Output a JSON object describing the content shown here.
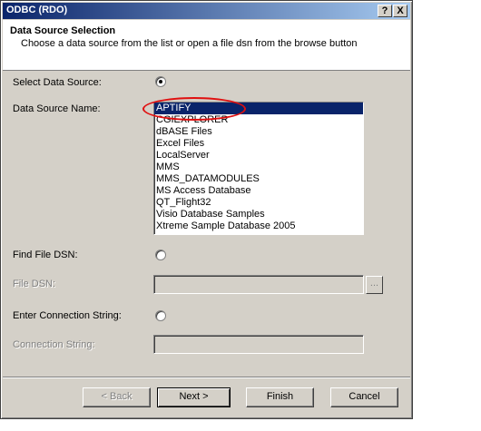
{
  "window": {
    "title": "ODBC (RDO)",
    "help_button": "?",
    "close_button": "X"
  },
  "header": {
    "title": "Data Source Selection",
    "subtitle": "Choose a data source from the list or open a file dsn from the browse button"
  },
  "form": {
    "select_data_source": {
      "label": "Select Data Source:",
      "selected": true
    },
    "data_source_name": {
      "label": "Data Source Name:",
      "items": [
        "APTIFY",
        "CGIEXPLORER",
        "dBASE Files",
        "Excel Files",
        "LocalServer",
        "MMS",
        "MMS_DATAMODULES",
        "MS Access Database",
        "QT_Flight32",
        "Visio Database Samples",
        "Xtreme Sample Database 2005"
      ],
      "selected_item": "APTIFY"
    },
    "find_file_dsn": {
      "label": "Find File DSN:",
      "selected": false
    },
    "file_dsn": {
      "label": "File DSN:",
      "value": "",
      "browse_label": "..."
    },
    "enter_connection_string": {
      "label": "Enter Connection String:",
      "selected": false
    },
    "connection_string": {
      "label": "Connection String:",
      "value": ""
    }
  },
  "buttons": {
    "back": "< Back",
    "next": "Next >",
    "finish": "Finish",
    "cancel": "Cancel"
  },
  "colors": {
    "titlebar_start": "#0a246a",
    "titlebar_end": "#a6caf0",
    "selection": "#0a246a",
    "annotation": "#e01010",
    "dialog_face": "#d4d0c8"
  }
}
